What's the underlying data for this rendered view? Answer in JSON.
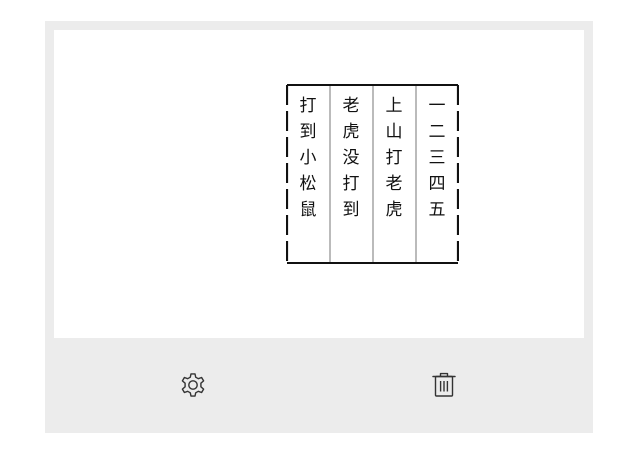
{
  "poem": {
    "columns": [
      [
        "打",
        "到",
        "小",
        "松",
        "鼠"
      ],
      [
        "老",
        "虎",
        "没",
        "打",
        "到"
      ],
      [
        "上",
        "山",
        "打",
        "老",
        "虎"
      ],
      [
        "一",
        "二",
        "三",
        "四",
        "五"
      ]
    ]
  },
  "footer": {
    "settings_icon": "gear-icon",
    "delete_icon": "trash-icon"
  },
  "colors": {
    "card_background": "#ececec",
    "content_background": "#ffffff",
    "text": "#111111",
    "icon": "#333333"
  }
}
